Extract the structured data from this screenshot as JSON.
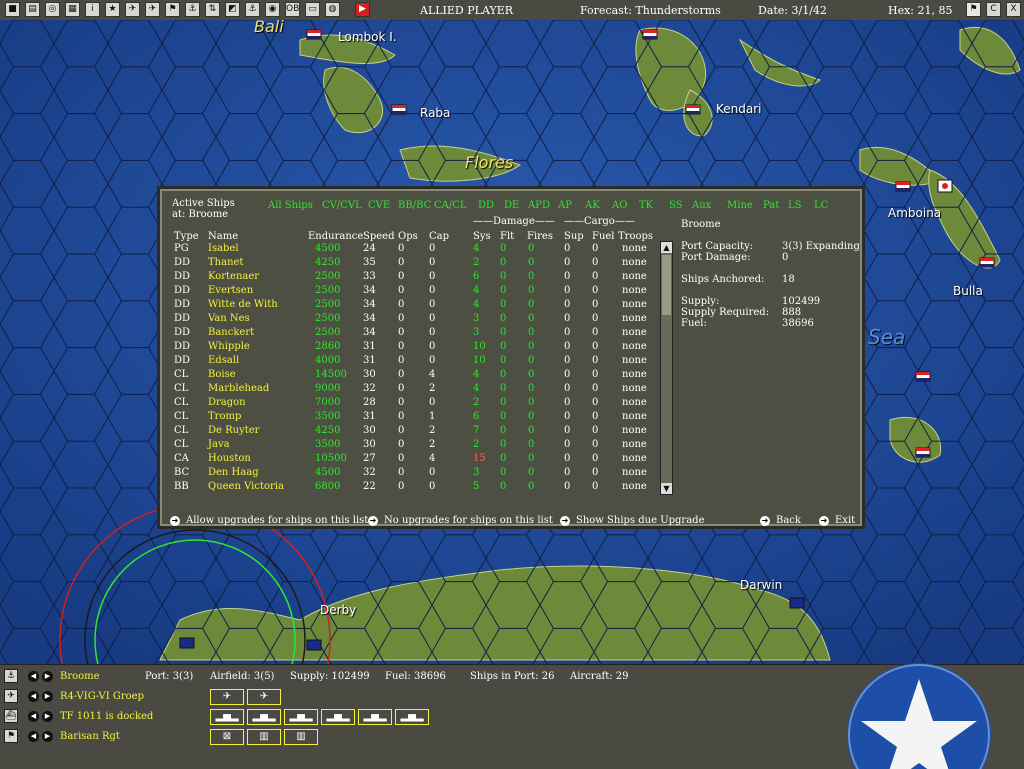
{
  "topbar": {
    "buttons": [
      "■",
      "▤",
      "◎",
      "▦",
      "i",
      "★",
      "✈",
      "✈",
      "⚑",
      "⚓",
      "⇅",
      "◩",
      "⚓",
      "◉",
      "OB",
      "▭",
      "◍",
      "▶"
    ],
    "player": "ALLIED PLAYER",
    "forecast": "Forecast: Thunderstorms",
    "date": "Date: 3/1/42",
    "hex": "Hex: 21, 85",
    "right_buttons": [
      "⚑",
      "C",
      "X"
    ]
  },
  "map": {
    "labels": [
      "Bali",
      "Lombok I.",
      "Raba",
      "Flores",
      "Kendari",
      "Amboina",
      "Bulla",
      "Sea",
      "Derby",
      "Darwin"
    ]
  },
  "dialog": {
    "title_line1": "Active Ships",
    "title_line2": "at: Broome",
    "filters": [
      "All Ships",
      "CV/CVL",
      "CVE",
      "BB/BC",
      "CA/CL",
      "DD",
      "DE",
      "APD",
      "AP",
      "AK",
      "AO",
      "TK",
      "SS",
      "Aux",
      "Mine",
      "Pat",
      "LS",
      "LC"
    ],
    "group_damage": "Damage",
    "group_cargo": "Cargo",
    "columns": [
      "Type",
      "Name",
      "Endurance",
      "Speed",
      "Ops",
      "Cap",
      "Sys",
      "Flt",
      "Fires",
      "Sup",
      "Fuel",
      "Troops"
    ],
    "rows": [
      {
        "type": "PG",
        "name": "Isabel",
        "end": "4500",
        "spd": "24",
        "ops": "0",
        "cap": "0",
        "sys": "4",
        "flt": "0",
        "fires": "0",
        "sup": "0",
        "fuel": "0",
        "troops": "none"
      },
      {
        "type": "DD",
        "name": "Thanet",
        "end": "4250",
        "spd": "35",
        "ops": "0",
        "cap": "0",
        "sys": "2",
        "flt": "0",
        "fires": "0",
        "sup": "0",
        "fuel": "0",
        "troops": "none"
      },
      {
        "type": "DD",
        "name": "Kortenaer",
        "end": "2500",
        "spd": "33",
        "ops": "0",
        "cap": "0",
        "sys": "6",
        "flt": "0",
        "fires": "0",
        "sup": "0",
        "fuel": "0",
        "troops": "none"
      },
      {
        "type": "DD",
        "name": "Evertsen",
        "end": "2500",
        "spd": "34",
        "ops": "0",
        "cap": "0",
        "sys": "4",
        "flt": "0",
        "fires": "0",
        "sup": "0",
        "fuel": "0",
        "troops": "none"
      },
      {
        "type": "DD",
        "name": "Witte de With",
        "end": "2500",
        "spd": "34",
        "ops": "0",
        "cap": "0",
        "sys": "4",
        "flt": "0",
        "fires": "0",
        "sup": "0",
        "fuel": "0",
        "troops": "none"
      },
      {
        "type": "DD",
        "name": "Van Nes",
        "end": "2500",
        "spd": "34",
        "ops": "0",
        "cap": "0",
        "sys": "3",
        "flt": "0",
        "fires": "0",
        "sup": "0",
        "fuel": "0",
        "troops": "none"
      },
      {
        "type": "DD",
        "name": "Banckert",
        "end": "2500",
        "spd": "34",
        "ops": "0",
        "cap": "0",
        "sys": "3",
        "flt": "0",
        "fires": "0",
        "sup": "0",
        "fuel": "0",
        "troops": "none"
      },
      {
        "type": "DD",
        "name": "Whipple",
        "end": "2860",
        "spd": "31",
        "ops": "0",
        "cap": "0",
        "sys": "10",
        "flt": "0",
        "fires": "0",
        "sup": "0",
        "fuel": "0",
        "troops": "none"
      },
      {
        "type": "DD",
        "name": "Edsall",
        "end": "4000",
        "spd": "31",
        "ops": "0",
        "cap": "0",
        "sys": "10",
        "flt": "0",
        "fires": "0",
        "sup": "0",
        "fuel": "0",
        "troops": "none"
      },
      {
        "type": "CL",
        "name": "Boise",
        "end": "14500",
        "spd": "30",
        "ops": "0",
        "cap": "4",
        "sys": "4",
        "flt": "0",
        "fires": "0",
        "sup": "0",
        "fuel": "0",
        "troops": "none"
      },
      {
        "type": "CL",
        "name": "Marblehead",
        "end": "9000",
        "spd": "32",
        "ops": "0",
        "cap": "2",
        "sys": "4",
        "flt": "0",
        "fires": "0",
        "sup": "0",
        "fuel": "0",
        "troops": "none"
      },
      {
        "type": "CL",
        "name": "Dragon",
        "end": "7000",
        "spd": "28",
        "ops": "0",
        "cap": "0",
        "sys": "2",
        "flt": "0",
        "fires": "0",
        "sup": "0",
        "fuel": "0",
        "troops": "none"
      },
      {
        "type": "CL",
        "name": "Tromp",
        "end": "3500",
        "spd": "31",
        "ops": "0",
        "cap": "1",
        "sys": "6",
        "flt": "0",
        "fires": "0",
        "sup": "0",
        "fuel": "0",
        "troops": "none"
      },
      {
        "type": "CL",
        "name": "De Ruyter",
        "end": "4250",
        "spd": "30",
        "ops": "0",
        "cap": "2",
        "sys": "7",
        "flt": "0",
        "fires": "0",
        "sup": "0",
        "fuel": "0",
        "troops": "none"
      },
      {
        "type": "CL",
        "name": "Java",
        "end": "3500",
        "spd": "30",
        "ops": "0",
        "cap": "2",
        "sys": "2",
        "flt": "0",
        "fires": "0",
        "sup": "0",
        "fuel": "0",
        "troops": "none"
      },
      {
        "type": "CA",
        "name": "Houston",
        "end": "10500",
        "spd": "27",
        "ops": "0",
        "cap": "4",
        "sys": "15",
        "flt": "0",
        "fires": "0",
        "sup": "0",
        "fuel": "0",
        "troops": "none",
        "sys_alert": true
      },
      {
        "type": "BC",
        "name": "Den Haag",
        "end": "4500",
        "spd": "32",
        "ops": "0",
        "cap": "0",
        "sys": "3",
        "flt": "0",
        "fires": "0",
        "sup": "0",
        "fuel": "0",
        "troops": "none"
      },
      {
        "type": "BB",
        "name": "Queen Victoria",
        "end": "6800",
        "spd": "22",
        "ops": "0",
        "cap": "0",
        "sys": "5",
        "flt": "0",
        "fires": "0",
        "sup": "0",
        "fuel": "0",
        "troops": "none"
      }
    ],
    "info": {
      "base_name": "Broome",
      "port_capacity_label": "Port Capacity:",
      "port_capacity": "3(3) Expanding",
      "port_damage_label": "Port Damage:",
      "port_damage": "0",
      "ships_anchored_label": "Ships Anchored:",
      "ships_anchored": "18",
      "supply_label": "Supply:",
      "supply": "102499",
      "supply_required_label": "Supply Required:",
      "supply_required": "888",
      "fuel_label": "Fuel:",
      "fuel": "38696"
    },
    "actions": {
      "allow_upgrades": "Allow upgrades for ships on this list",
      "no_upgrades": "No upgrades for ships on this list",
      "show_upgrade": "Show Ships due Upgrade",
      "back": "Back",
      "exit": "Exit"
    }
  },
  "bottom": {
    "base": "Broome",
    "air_unit": "R4-VIG-VI Groep",
    "task_force": "TF 1011 is docked",
    "land_unit": "Barisan Rgt",
    "port": "Port: 3(3)",
    "airfield": "Airfield: 3(5)",
    "supply": "Supply: 102499",
    "fuel": "Fuel: 38696",
    "ships_in_port": "Ships in Port: 26",
    "aircraft": "Aircraft: 29"
  },
  "colors": {
    "green": "#2ee62e",
    "yellow": "#f2f23a",
    "red": "#ff6a4a",
    "panel": "#4e4f43",
    "ocean": "#1a3f8c"
  }
}
